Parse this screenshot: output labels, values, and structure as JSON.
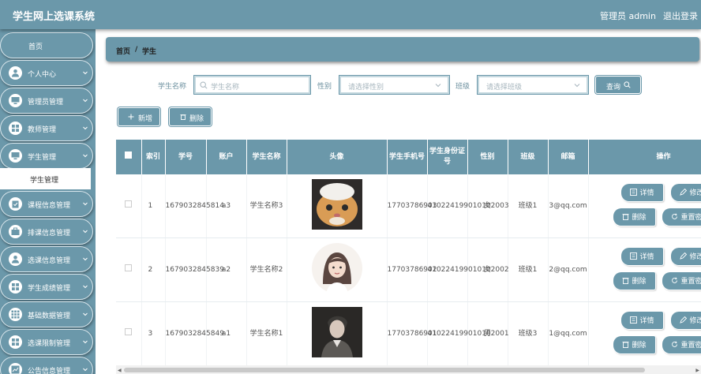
{
  "header": {
    "title": "学生网上选课系统",
    "user": "管理员 admin",
    "logout": "退出登录"
  },
  "sidebar": {
    "home": "首页",
    "items": [
      {
        "label": "个人中心",
        "icon": "person-icon"
      },
      {
        "label": "管理员管理",
        "icon": "monitor-icon"
      },
      {
        "label": "教师管理",
        "icon": "grid-icon"
      },
      {
        "label": "学生管理",
        "icon": "monitor-icon"
      },
      {
        "label": "课程信息管理",
        "icon": "clipboard-icon"
      },
      {
        "label": "排课信息管理",
        "icon": "briefcase-icon"
      },
      {
        "label": "选课信息管理",
        "icon": "person-icon"
      },
      {
        "label": "学生成绩管理",
        "icon": "grid-icon"
      },
      {
        "label": "基础数据管理",
        "icon": "apps-icon"
      },
      {
        "label": "选课限制管理",
        "icon": "grid-icon"
      },
      {
        "label": "公告信息管理",
        "icon": "chart-icon"
      }
    ],
    "active_sub": "学生管理"
  },
  "breadcrumb": {
    "home": "首页",
    "sep": "/",
    "current": "学生"
  },
  "search": {
    "name_label": "学生名称",
    "name_placeholder": "学生名称",
    "gender_label": "性别",
    "gender_placeholder": "请选择性别",
    "class_label": "班级",
    "class_placeholder": "请选择班级",
    "query_button": "查询"
  },
  "actions": {
    "add": "新增",
    "delete": "删除"
  },
  "table": {
    "headers": [
      "",
      "索引",
      "学号",
      "账户",
      "学生名称",
      "头像",
      "学生手机号",
      "学生身份证号",
      "性别",
      "班级",
      "邮箱",
      "操作"
    ],
    "ops": {
      "detail": "详情",
      "edit": "修改",
      "delete": "删除",
      "reset": "重置密码"
    },
    "rows": [
      {
        "index": "1",
        "student_no": "1679032845814",
        "account": "a3",
        "name": "学生名称3",
        "avatar": "cat",
        "phone": "17703786903",
        "id_card": "410224199010102003",
        "gender": "女",
        "class": "班级1",
        "email": "3@qq.com"
      },
      {
        "index": "2",
        "student_no": "1679032845839",
        "account": "a2",
        "name": "学生名称2",
        "avatar": "girl",
        "phone": "17703786902",
        "id_card": "410224199010102002",
        "gender": "女",
        "class": "班级1",
        "email": "2@qq.com"
      },
      {
        "index": "3",
        "student_no": "1679032845849",
        "account": "a1",
        "name": "学生名称1",
        "avatar": "man",
        "phone": "17703786901",
        "id_card": "410224199010102001",
        "gender": "男",
        "class": "班级3",
        "email": "1@qq.com"
      }
    ]
  },
  "colors": {
    "primary": "#6b98aa",
    "text": "#444444"
  }
}
